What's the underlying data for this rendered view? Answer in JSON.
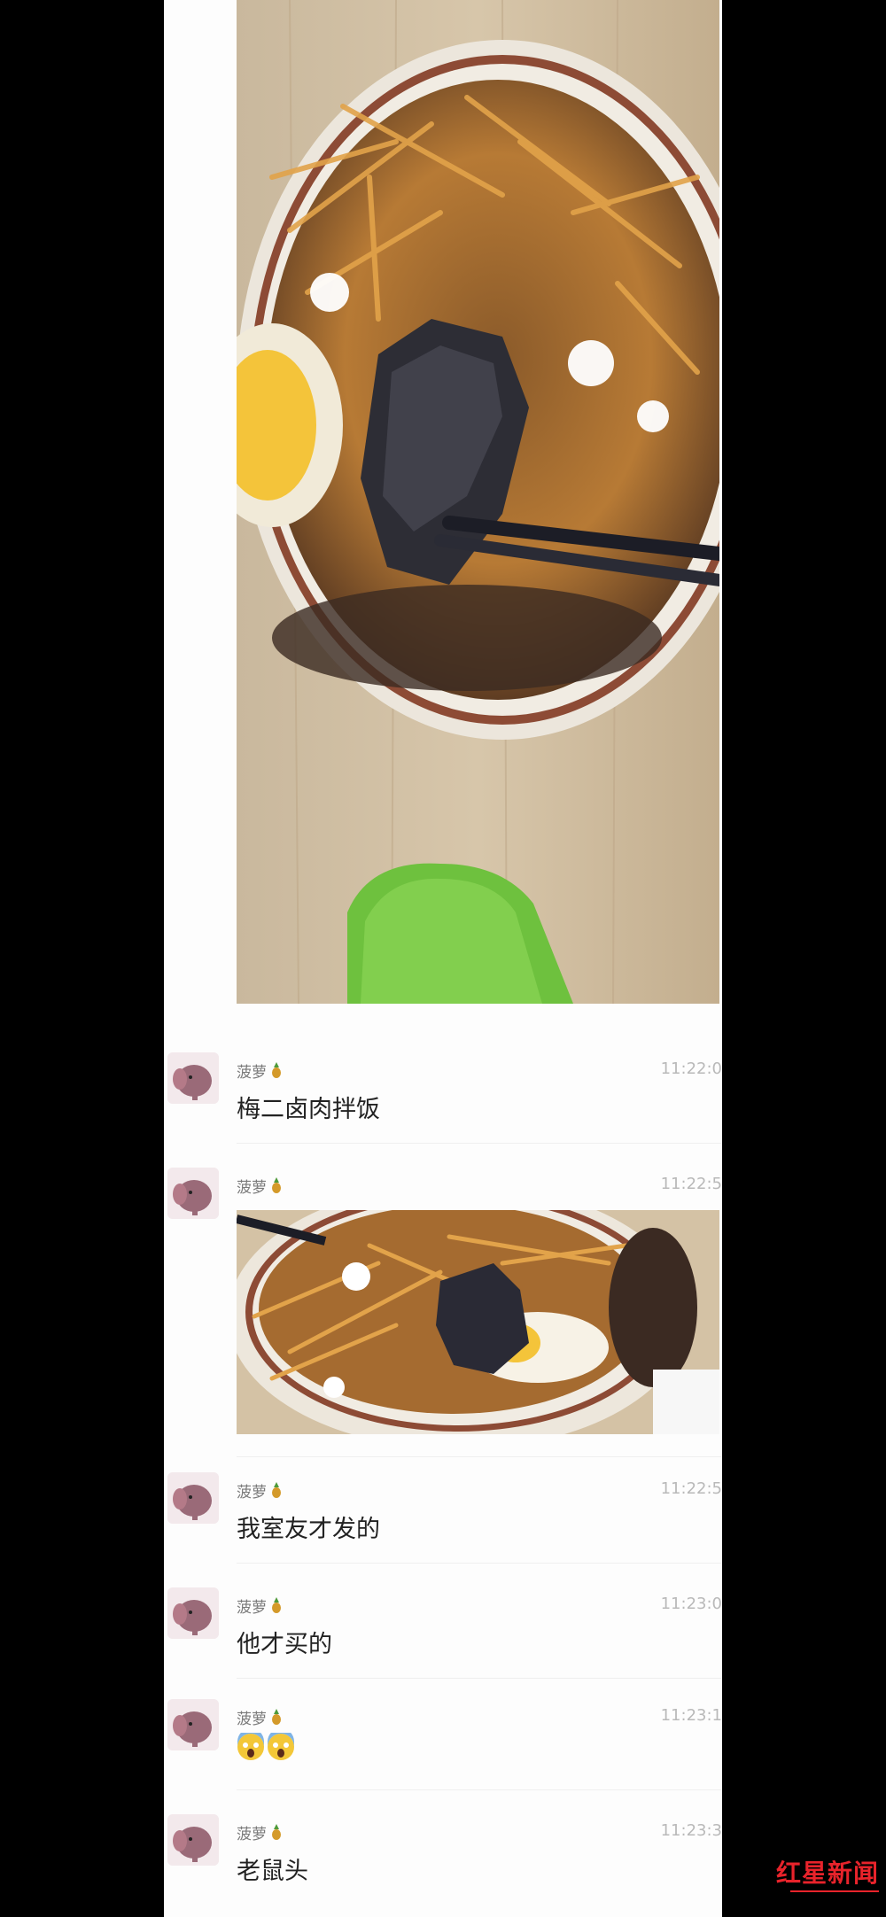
{
  "chat": {
    "messages": [
      {
        "sender": "菠萝",
        "time": "11:22:0",
        "text": "梅二卤肉拌饭"
      },
      {
        "sender": "菠萝",
        "time": "11:22:5",
        "type": "image"
      },
      {
        "sender": "菠萝",
        "time": "11:22:5",
        "text": "我室友才发的"
      },
      {
        "sender": "菠萝",
        "time": "11:23:0",
        "text": "他才买的"
      },
      {
        "sender": "菠萝",
        "time": "11:23:1",
        "emoji": [
          "scream-emoji",
          "scream-emoji"
        ]
      },
      {
        "sender": "菠萝",
        "time": "11:23:3",
        "text": "老鼠头"
      }
    ]
  },
  "watermark": {
    "text": "红星新闻"
  },
  "colors": {
    "watermark": "#e8232b",
    "background": "#000000",
    "chat_bg": "#fdfdfd"
  }
}
